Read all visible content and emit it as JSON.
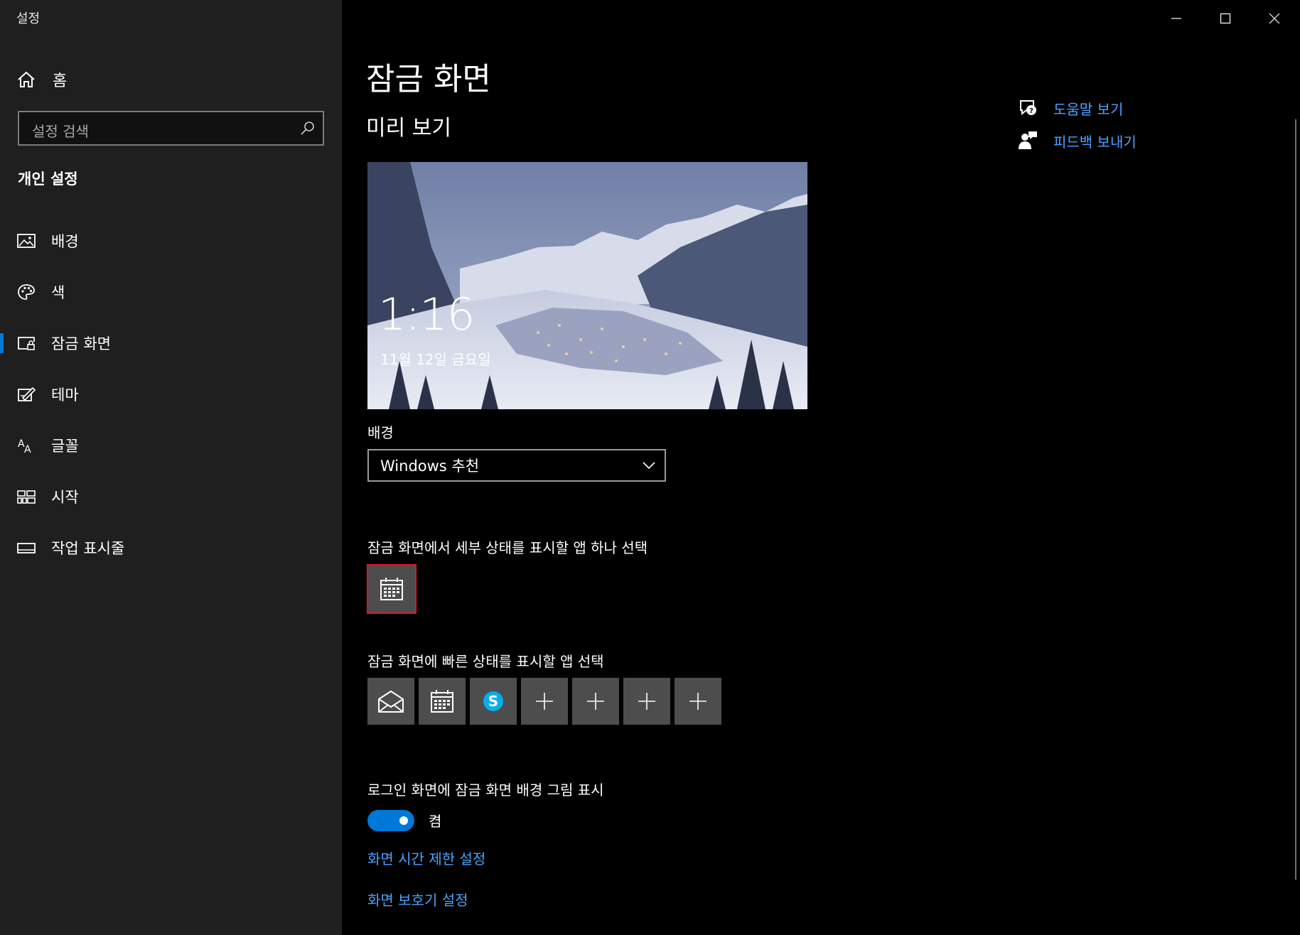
{
  "window": {
    "title": "설정",
    "minimize_icon": "minimize-icon",
    "maximize_icon": "maximize-icon",
    "close_icon": "close-icon"
  },
  "sidebar": {
    "home_label": "홈",
    "search_placeholder": "설정 검색",
    "section_title": "개인 설정",
    "items": [
      {
        "label": "배경",
        "icon": "picture-icon"
      },
      {
        "label": "색",
        "icon": "palette-icon"
      },
      {
        "label": "잠금 화면",
        "icon": "lock-screen-icon",
        "active": true
      },
      {
        "label": "테마",
        "icon": "theme-brush-icon"
      },
      {
        "label": "글꼴",
        "icon": "font-icon"
      },
      {
        "label": "시작",
        "icon": "start-tiles-icon"
      },
      {
        "label": "작업 표시줄",
        "icon": "taskbar-icon"
      }
    ],
    "accent_color": "#0078d7"
  },
  "main": {
    "page_title": "잠금 화면",
    "preview_title": "미리 보기",
    "preview": {
      "time": "1:16",
      "date": "11월 12일 금요일"
    },
    "background_label": "배경",
    "background_value": "Windows 추천",
    "detail_status_label": "잠금 화면에서 세부 상태를 표시할 앱 하나 선택",
    "detail_app_icon": "calendar-icon",
    "quick_status_label": "잠금 화면에 빠른 상태를 표시할 앱 선택",
    "quick_apps": [
      "mail-icon",
      "calendar-icon",
      "skype-icon",
      "plus-icon",
      "plus-icon",
      "plus-icon",
      "plus-icon"
    ],
    "login_bg_label": "로그인 화면에 잠금 화면 배경 그림 표시",
    "login_bg_toggle": "켬",
    "login_bg_on": true,
    "link_timeout": "화면 시간 제한 설정",
    "link_screensaver": "화면 보호기 설정"
  },
  "related": {
    "help_label": "도움말 보기",
    "feedback_label": "피드백 보내기",
    "link_color": "#4aa3ff"
  }
}
